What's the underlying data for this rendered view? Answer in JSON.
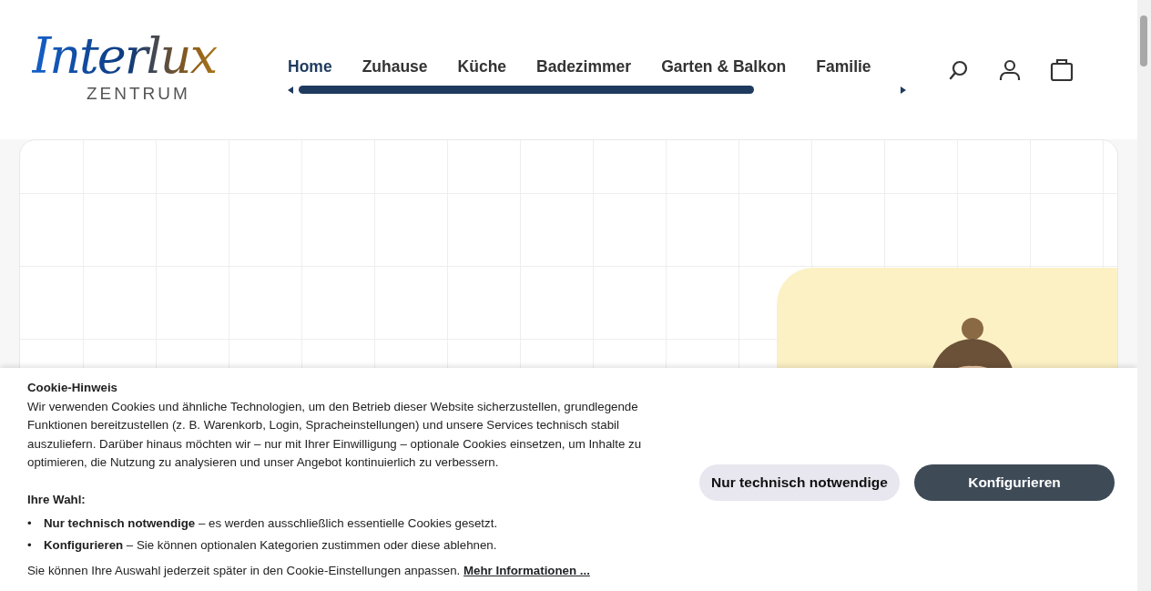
{
  "logo": {
    "wordmark": "Interlux",
    "subtitle": "ZENTRUM"
  },
  "nav": [
    {
      "label": "Home",
      "selected": true
    },
    {
      "label": "Zuhause",
      "selected": false
    },
    {
      "label": "Küche",
      "selected": false
    },
    {
      "label": "Badezimmer",
      "selected": false
    },
    {
      "label": "Garten & Balkon",
      "selected": false
    },
    {
      "label": "Familie",
      "selected": false
    }
  ],
  "cookie_banner": {
    "title": "Cookie-Hinweis",
    "paragraph": "Wir verwenden Cookies und ähnliche Technologien, um den Betrieb dieser Website sicherzustellen, grundlegende Funktionen bereitzustellen (z. B. Warenkorb, Login, Spracheinstellungen) und unsere Services technisch stabil auszuliefern. Darüber hinaus möchten wir – nur mit Ihrer Einwilligung – optionale Cookies einsetzen, um Inhalte zu optimieren, die Nutzung zu analysieren und unser Angebot kontinuierlich zu verbessern.",
    "choice_heading": "Ihre Wahl:",
    "options": [
      {
        "marker": "•",
        "text": "**Nur technisch notwendige** – es werden ausschließlich essentielle Cookies gesetzt."
      },
      {
        "marker": "•",
        "text": "**Konfigurieren** – Sie können optionalen Kategorien zustimmen oder diese ablehnen."
      }
    ],
    "footer_text": "Sie können Ihre Auswahl jederzeit später in den Cookie-Einstellungen anpassen.",
    "footer_link": "Mehr Informationen ...",
    "buttons": [
      {
        "label": "Nur technisch notwendige",
        "kind": "secondary"
      },
      {
        "label": "Konfigurieren",
        "kind": "primary"
      }
    ]
  }
}
